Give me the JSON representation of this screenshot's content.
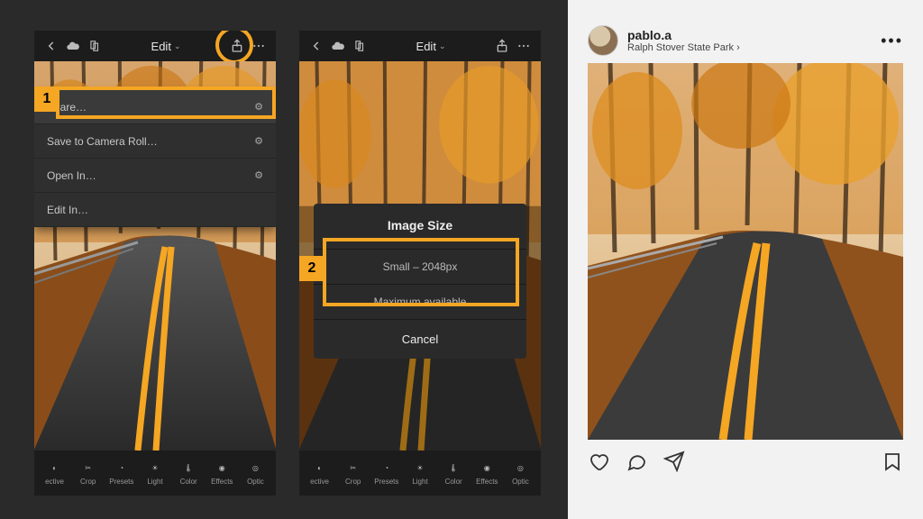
{
  "phone": {
    "topbar": {
      "edit": "Edit"
    },
    "tools": {
      "selective": "ective",
      "crop": "Crop",
      "presets": "Presets",
      "light": "Light",
      "color": "Color",
      "effects": "Effects",
      "optics": "Optic"
    },
    "share_menu": {
      "share": "Share…",
      "save": "Save to Camera Roll…",
      "open": "Open In…",
      "edit": "Edit In…"
    },
    "dialog": {
      "title": "Image Size",
      "small": "Small – 2048px",
      "max": "Maximum available",
      "cancel": "Cancel"
    }
  },
  "badges": {
    "one": "1",
    "two": "2"
  },
  "instagram": {
    "username": "pablo.a",
    "location": "Ralph Stover State Park"
  }
}
